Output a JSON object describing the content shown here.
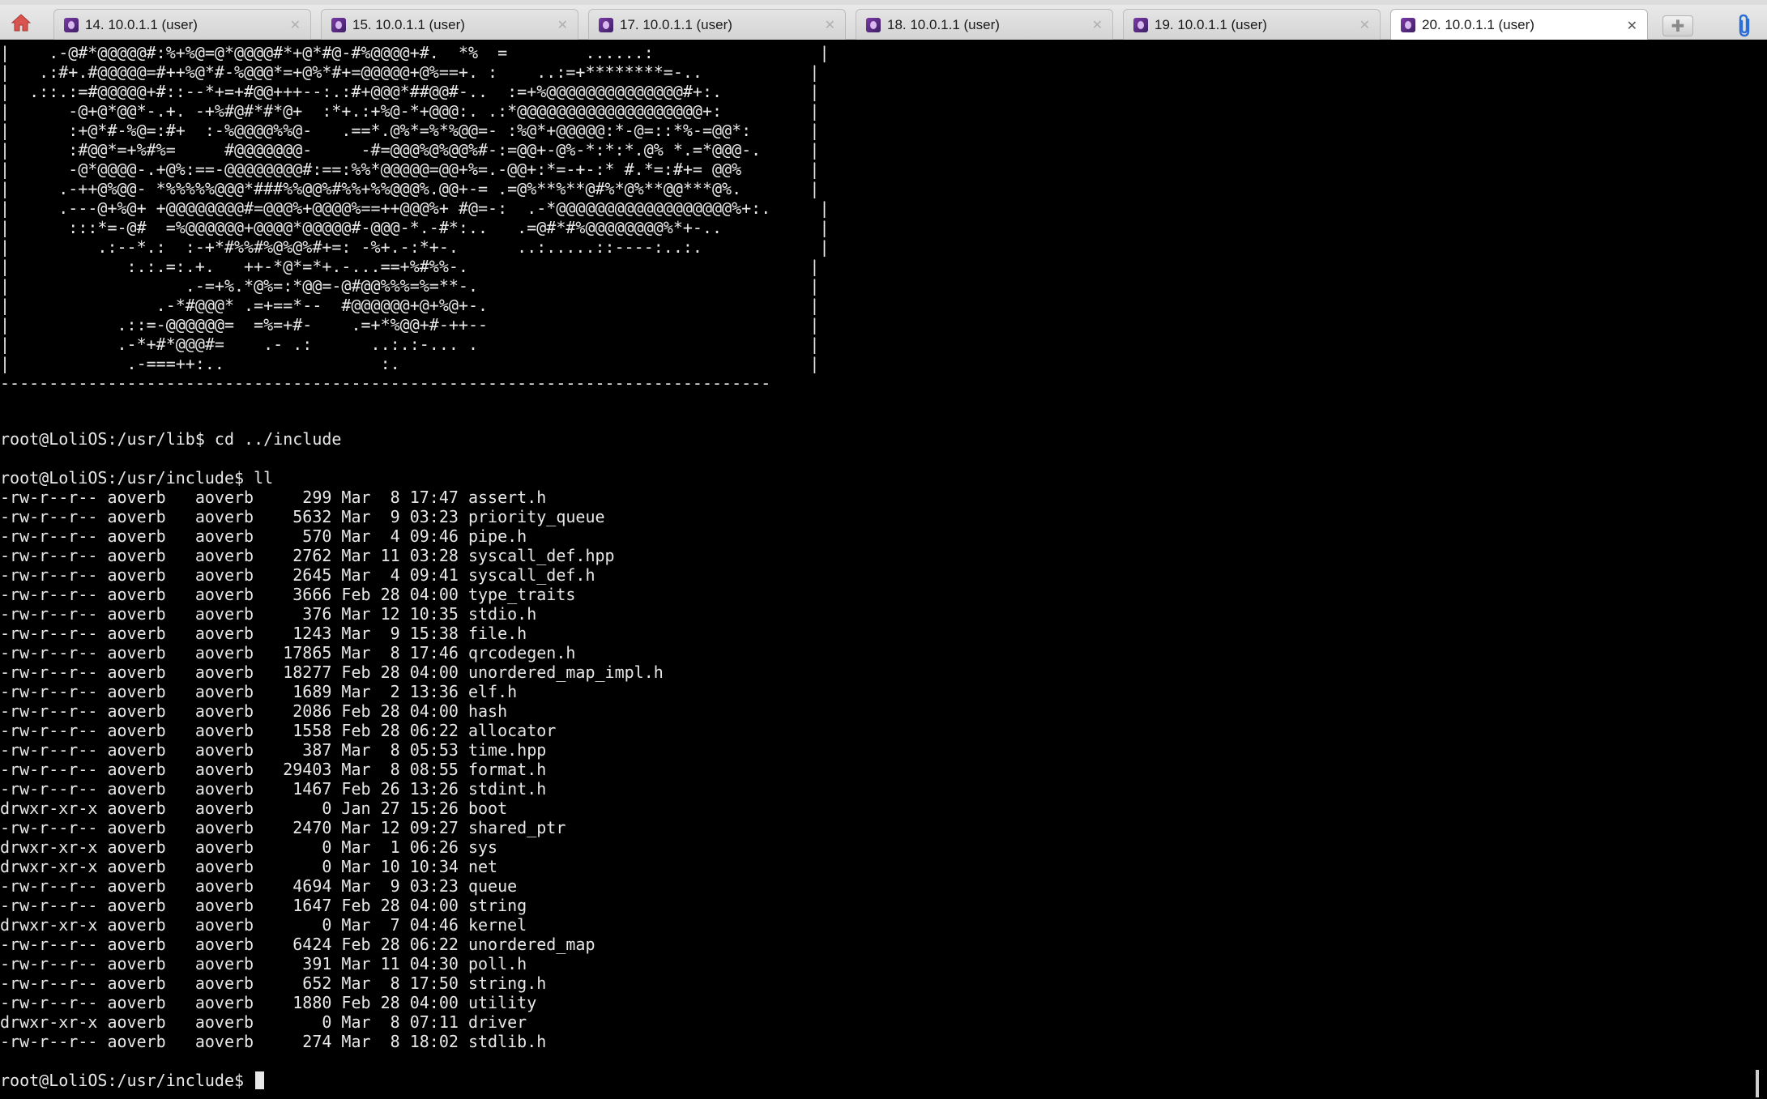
{
  "tabs": [
    {
      "label": "14. 10.0.1.1 (user)",
      "active": false
    },
    {
      "label": "15. 10.0.1.1 (user)",
      "active": false
    },
    {
      "label": "17. 10.0.1.1 (user)",
      "active": false
    },
    {
      "label": "18. 10.0.1.1 (user)",
      "active": false
    },
    {
      "label": "19. 10.0.1.1 (user)",
      "active": false
    },
    {
      "label": "20. 10.0.1.1 (user)",
      "active": true
    }
  ],
  "icons": {
    "home": "home-icon",
    "tab": "session-icon",
    "close": "close-icon",
    "new_tab": "new-tab-icon",
    "attach": "paperclip-icon"
  },
  "colors": {
    "background": "#000000",
    "text": "#e8e8e8",
    "home_icon": "#d9534f",
    "attach_icon": "#2b6fd6"
  },
  "terminal": {
    "ascii_art": [
      "|    .-@#*@@@@@#:%+%@=@*@@@@#*+@*#@-#%@@@@+#.  *%  =        ......:                 |",
      "|   .:#+.#@@@@@=#++%@*#-%@@@*=+@%*#+=@@@@@+@%==+. :    ..:=+********=-..           |",
      "|  .::.:=#@@@@@+#::--*+=+#@@+++--:.:#+@@@*##@@#-..  :=+%@@@@@@@@@@@@@@#+:.         |",
      "|      -@+@*@@*-.+. -+%#@#*#*@+  :*+.:+%@-*+@@@:. .:*@@@@@@@@@@@@@@@@@@@+:         |",
      "|      :+@*#-%@=:#+  :-%@@@@%%@-   .==*.@%*=%*%@@=- :%@*+@@@@@:*-@=::*%-=@@*:      |",
      "|      :#@@*=+%#%=     #@@@@@@@-     -#=@@@%@%@@%#-:=@@+-@%-*:*:*.@% *.=*@@@-.     |",
      "|      -@*@@@@-.+@%:==-@@@@@@@@#:==:%%*@@@@@=@@+%=.-@@+:*=-+-:* #.*=:#+= @@%       |",
      "|     .-++@%@@- *%%%%%@@@*###%%@@%#%%+%%@@@%.@@+-= .=@%**%**@#%*@%**@@***@%.       |",
      "|     .---@+%@+ +@@@@@@@@#=@@@%+@@@@%==++@@@%+ #@=-:  .-*@@@@@@@@@@@@@@@@@@%+:.     |",
      "|      :::*=-@#  =%@@@@@@+@@@@*@@@@@#-@@@-*.-#*:..   .=@#*#%@@@@@@@@%*+-..          |",
      "|         .:--*.:  :-+*#%%#%@%@%#+=: -%+.-:*+-.      ..:.....::----:..:.            |",
      "|            :.:.=:.+.   ++-*@*=*+.-...==+%#%%-.                                   |",
      "|                  .-=+%.*@%=:*@@=-@#@@%%%=%=**-.                                  |",
      "|               .-*#@@@* .=+==*--  #@@@@@@+@+%@+-.                                 |",
      "|           .::=-@@@@@@=  =%=+#-    .=+*%@@+#-++--                                 |",
      "|           .-*+#*@@@#=    .- .:      ..:.:-... .                                  |",
      "|            .-===++:..                :.                                          |"
    ],
    "separator": "-------------------------------------------------------------------------------",
    "cmd1": "root@LoliOS:/usr/lib$ cd ../include",
    "cmd2": "root@LoliOS:/usr/include$ ll",
    "listing": [
      "-rw-r--r-- aoverb   aoverb     299 Mar  8 17:47 assert.h",
      "-rw-r--r-- aoverb   aoverb    5632 Mar  9 03:23 priority_queue",
      "-rw-r--r-- aoverb   aoverb     570 Mar  4 09:46 pipe.h",
      "-rw-r--r-- aoverb   aoverb    2762 Mar 11 03:28 syscall_def.hpp",
      "-rw-r--r-- aoverb   aoverb    2645 Mar  4 09:41 syscall_def.h",
      "-rw-r--r-- aoverb   aoverb    3666 Feb 28 04:00 type_traits",
      "-rw-r--r-- aoverb   aoverb     376 Mar 12 10:35 stdio.h",
      "-rw-r--r-- aoverb   aoverb    1243 Mar  9 15:38 file.h",
      "-rw-r--r-- aoverb   aoverb   17865 Mar  8 17:46 qrcodegen.h",
      "-rw-r--r-- aoverb   aoverb   18277 Feb 28 04:00 unordered_map_impl.h",
      "-rw-r--r-- aoverb   aoverb    1689 Mar  2 13:36 elf.h",
      "-rw-r--r-- aoverb   aoverb    2086 Feb 28 04:00 hash",
      "-rw-r--r-- aoverb   aoverb    1558 Feb 28 06:22 allocator",
      "-rw-r--r-- aoverb   aoverb     387 Mar  8 05:53 time.hpp",
      "-rw-r--r-- aoverb   aoverb   29403 Mar  8 08:55 format.h",
      "-rw-r--r-- aoverb   aoverb    1467 Feb 26 13:26 stdint.h",
      "drwxr-xr-x aoverb   aoverb       0 Jan 27 15:26 boot",
      "-rw-r--r-- aoverb   aoverb    2470 Mar 12 09:27 shared_ptr",
      "drwxr-xr-x aoverb   aoverb       0 Mar  1 06:26 sys",
      "drwxr-xr-x aoverb   aoverb       0 Mar 10 10:34 net",
      "-rw-r--r-- aoverb   aoverb    4694 Mar  9 03:23 queue",
      "-rw-r--r-- aoverb   aoverb    1647 Feb 28 04:00 string",
      "drwxr-xr-x aoverb   aoverb       0 Mar  7 04:46 kernel",
      "-rw-r--r-- aoverb   aoverb    6424 Feb 28 06:22 unordered_map",
      "-rw-r--r-- aoverb   aoverb     391 Mar 11 04:30 poll.h",
      "-rw-r--r-- aoverb   aoverb     652 Mar  8 17:50 string.h",
      "-rw-r--r-- aoverb   aoverb    1880 Feb 28 04:00 utility",
      "drwxr-xr-x aoverb   aoverb       0 Mar  8 07:11 driver",
      "-rw-r--r-- aoverb   aoverb     274 Mar  8 18:02 stdlib.h"
    ],
    "prompt": "root@LoliOS:/usr/include$ "
  }
}
